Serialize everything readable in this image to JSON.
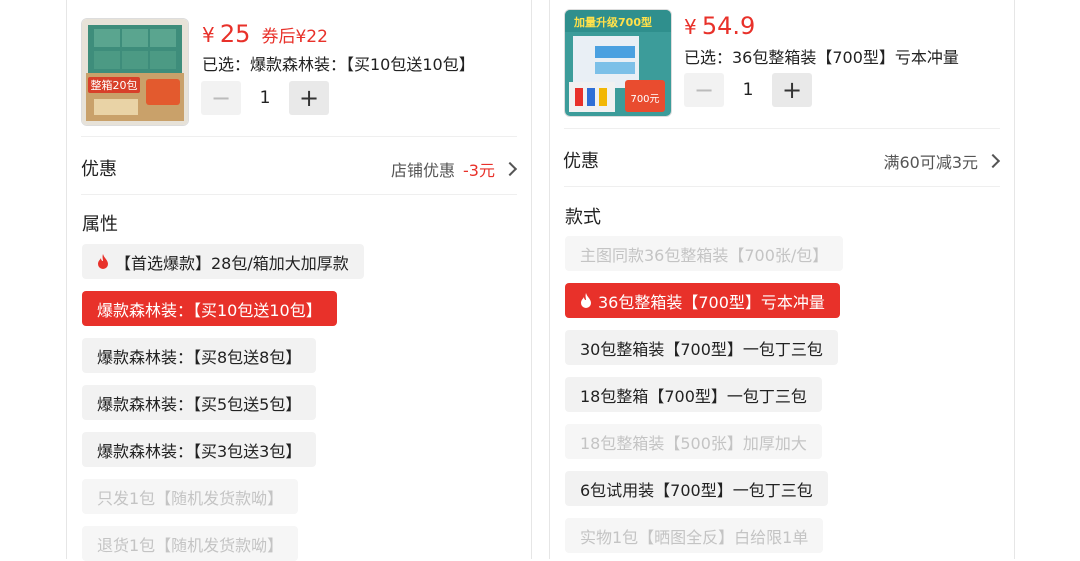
{
  "left": {
    "product": {
      "image_alt": "tissue carton product",
      "image_text": "整箱20包",
      "price_symbol": "¥",
      "price": "25",
      "coupon_price": "券后¥22",
      "selected_text": "已选：爆款森林装：【买10包送10包】",
      "quantity": "1",
      "minus": "−",
      "plus": "+"
    },
    "discount": {
      "label": "优惠",
      "value": "店铺优惠",
      "amount": "-3元"
    },
    "attribute_label": "属性",
    "options": [
      {
        "label": "【首选爆款】28包/箱加大加厚款",
        "state": "hot"
      },
      {
        "label": "爆款森林装：【买10包送10包】",
        "state": "active"
      },
      {
        "label": "爆款森林装：【买8包送8包】",
        "state": "normal"
      },
      {
        "label": "爆款森林装：【买5包送5包】",
        "state": "normal"
      },
      {
        "label": "爆款森林装：【买3包送3包】",
        "state": "normal"
      },
      {
        "label": "只发1包【随机发货款呦】",
        "state": "disabled"
      },
      {
        "label": "退货1包【随机发货款呦】",
        "state": "disabled"
      }
    ]
  },
  "right": {
    "product": {
      "image_alt": "tissue pack product",
      "image_title": "加量升级700型",
      "image_badge": "700元",
      "price_symbol": "¥",
      "price": "54.9",
      "selected_text": "已选：36包整箱装【700型】亏本冲量",
      "quantity": "1",
      "minus": "−",
      "plus": "+"
    },
    "discount": {
      "label": "优惠",
      "value": "满60可减3元"
    },
    "style_label": "款式",
    "options": [
      {
        "label": "主图同款36包整箱装【700张/包】",
        "state": "disabled"
      },
      {
        "label": "36包整箱装【700型】亏本冲量",
        "state": "active"
      },
      {
        "label": "30包整箱装【700型】一包丁三包",
        "state": "normal"
      },
      {
        "label": "18包整箱【700型】一包丁三包",
        "state": "normal"
      },
      {
        "label": "18包整箱装【500张】加厚加大",
        "state": "disabled"
      },
      {
        "label": "6包试用装【700型】一包丁三包",
        "state": "normal"
      },
      {
        "label": "实物1包【晒图全反】白给限1单",
        "state": "disabled"
      }
    ]
  },
  "colors": {
    "accent": "#e8312a",
    "disabled_text": "#c4c4c4",
    "chip_bg": "#f2f2f2"
  }
}
